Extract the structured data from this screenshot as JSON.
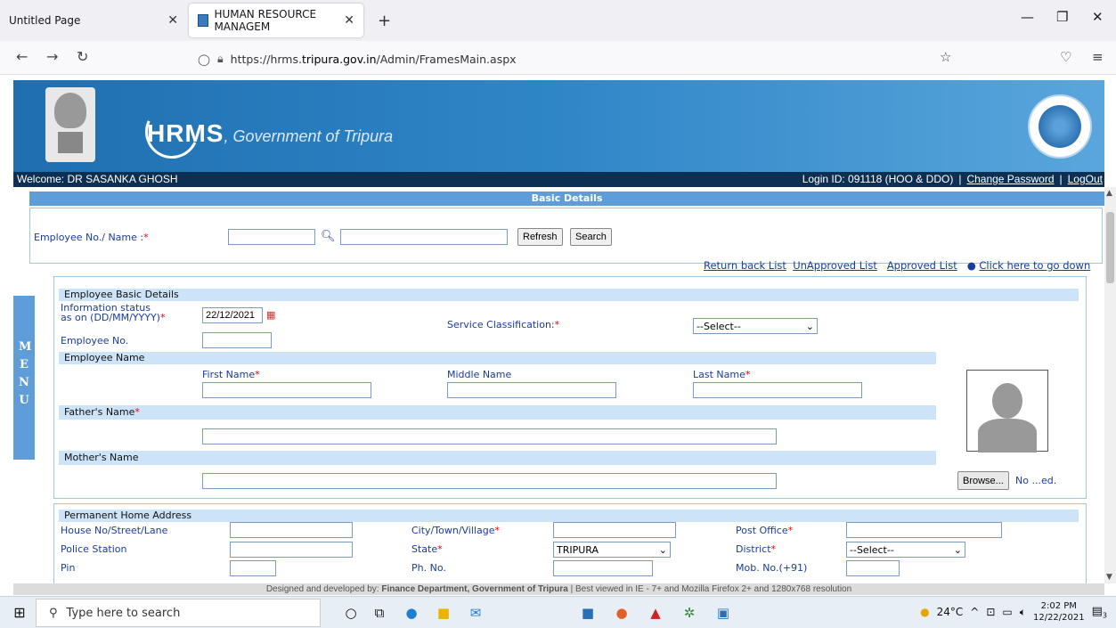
{
  "browser": {
    "tabs": [
      {
        "title": "Untitled Page",
        "active": false
      },
      {
        "title": "HUMAN RESOURCE MANAGEM",
        "active": true
      }
    ],
    "url_prefix": "https://hrms.",
    "url_domain": "tripura.gov.in",
    "url_path": "/Admin/FramesMain.aspx"
  },
  "banner": {
    "logo_text": "HRMS",
    "logo_suffix": ", Government of Tripura",
    "welcome": "Welcome: DR SASANKA GHOSH",
    "login_id": "Login ID: 091118 (HOO & DDO)",
    "change_password": "Change Password",
    "logout": "LogOut"
  },
  "search": {
    "section_title": "Basic Details",
    "label": "Employee No./ Name :",
    "refresh": "Refresh",
    "search": "Search"
  },
  "links": {
    "return": "Return back List",
    "unapproved": "UnApproved List",
    "approved": "Approved List",
    "go_down": "Click here to go down"
  },
  "menu_letters": "MENU",
  "basic": {
    "section_title": "Employee Basic Details",
    "info_status_line1": "Information status",
    "info_status_line2": "as on (DD/MM/YYYY)",
    "info_date": "22/12/2021",
    "service_class_label": "Service Classification:",
    "service_class_value": "--Select--",
    "employee_no": "Employee No.",
    "employee_name": "Employee Name",
    "first_name": "First Name",
    "middle_name": "Middle Name",
    "last_name": "Last Name",
    "fathers_name": "Father's Name",
    "mothers_name": "Mother's Name",
    "browse": "Browse...",
    "file_status": "No ...ed."
  },
  "address": {
    "section_title": "Permanent Home Address",
    "house": "House No/Street/Lane",
    "city": "City/Town/Village",
    "post_office": "Post Office",
    "police_station": "Police Station",
    "state": "State",
    "state_value": "TRIPURA",
    "district": "District",
    "district_value": "--Select--",
    "pin": "Pin",
    "phone": "Ph. No.",
    "mobile": "Mob. No.(+91)"
  },
  "footer": {
    "prefix": "Designed and developed by: ",
    "dept": "Finance Department, Government of Tripura",
    "suffix": " | Best viewed in IE - 7+ and Mozilla Firefox 2+ and 1280x768 resolution"
  },
  "taskbar": {
    "search_placeholder": "Type here to search",
    "weather": "24°C",
    "time": "2:02 PM",
    "date": "12/22/2021",
    "notifications": "3"
  }
}
